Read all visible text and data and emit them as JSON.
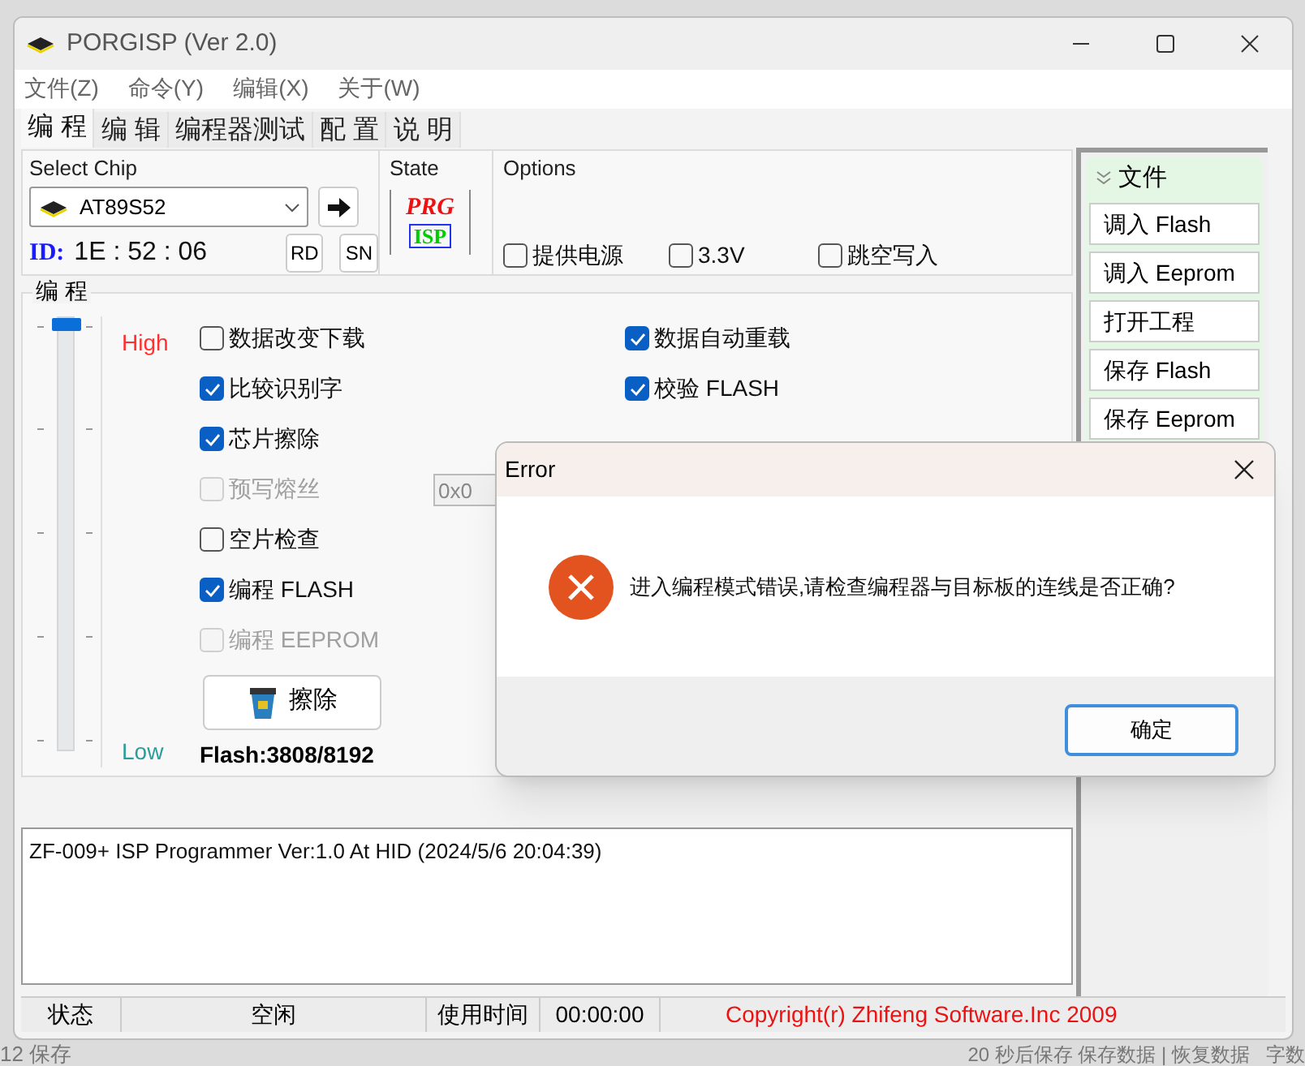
{
  "window": {
    "title": "PORGISP (Ver 2.0)"
  },
  "menu": [
    "文件(Z)",
    "命令(Y)",
    "编辑(X)",
    "关于(W)"
  ],
  "tabs": [
    {
      "label": "编 程",
      "selected": true
    },
    {
      "label": "编 辑",
      "selected": false
    },
    {
      "label": "编程器测试",
      "selected": false
    },
    {
      "label": "配 置",
      "selected": false
    },
    {
      "label": "说 明",
      "selected": false
    }
  ],
  "select_chip": {
    "title": "Select Chip",
    "chip": "AT89S52",
    "id_label": "ID:",
    "id_value": "1E : 52 : 06",
    "buttons": [
      "RD",
      "SN"
    ]
  },
  "state": {
    "title": "State",
    "logo_top": "PRG",
    "logo_bottom": "ISP"
  },
  "options": {
    "title": "Options",
    "items": [
      {
        "label": "提供电源",
        "checked": false,
        "disabled": false
      },
      {
        "label": "3.3V",
        "checked": false,
        "disabled": false
      },
      {
        "label": "跳空写入",
        "checked": false,
        "disabled": false
      }
    ]
  },
  "program": {
    "title": "编 程",
    "high": "High",
    "low": "Low",
    "level": 1,
    "left_items": [
      {
        "label": "数据改变下载",
        "checked": false,
        "disabled": false
      },
      {
        "label": "比较识别字",
        "checked": true,
        "disabled": false
      },
      {
        "label": "芯片擦除",
        "checked": true,
        "disabled": false
      },
      {
        "label": "预写熔丝",
        "checked": false,
        "disabled": true,
        "field": "0x0"
      },
      {
        "label": "空片检查",
        "checked": false,
        "disabled": false
      },
      {
        "label": "编程 FLASH",
        "checked": true,
        "disabled": false
      },
      {
        "label": "编程 EEPROM",
        "checked": false,
        "disabled": true
      }
    ],
    "right_items": [
      {
        "label": "数据自动重载",
        "checked": true,
        "disabled": false
      },
      {
        "label": "校验 FLASH",
        "checked": true,
        "disabled": false
      }
    ],
    "erase_button": "擦除",
    "flash": "Flash:3808/8192"
  },
  "log": [
    "ZF-009+ ISP Programmer Ver:1.0 At HID (2024/5/6 20:04:39)"
  ],
  "status_bar": {
    "cells": [
      "状态",
      "空闲",
      "使用时间",
      "00:00:00"
    ],
    "copyright": "Copyright(r) Zhifeng Software.Inc 2009"
  },
  "side_panel": {
    "title": "文件",
    "buttons": [
      "调入 Flash",
      "调入 Eeprom",
      "打开工程",
      "保存 Flash",
      "保存 Eeprom"
    ]
  },
  "dialog": {
    "title": "Error",
    "message": "进入编程模式错误,请检查编程器与目标板的连线是否正确?",
    "ok": "确定"
  },
  "background": {
    "left_text": "12 保存",
    "right_text": "20 秒后保存 保存数据 | 恢复数据   字数"
  }
}
